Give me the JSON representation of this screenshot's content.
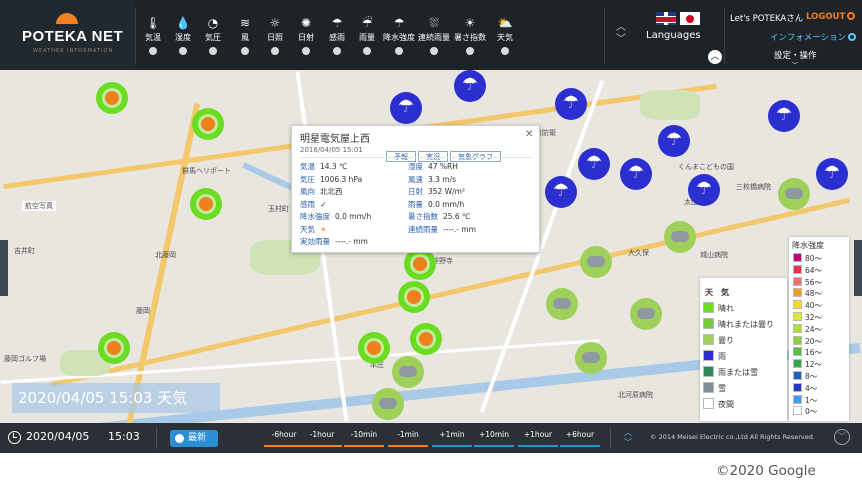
{
  "header": {
    "app_title": "POTEKA NET",
    "app_subtitle": "WEATHER INFORMATION",
    "tools": [
      {
        "label": "気温",
        "icon": "thermometer-icon",
        "glyph": "🌡"
      },
      {
        "label": "湿度",
        "icon": "droplet-icon",
        "glyph": "💧"
      },
      {
        "label": "気圧",
        "icon": "gauge-icon",
        "glyph": "◔"
      },
      {
        "label": "風",
        "icon": "wind-icon",
        "glyph": "≋"
      },
      {
        "label": "日照",
        "icon": "sunshine-icon",
        "glyph": "☼"
      },
      {
        "label": "日射",
        "icon": "solar-radiation-icon",
        "glyph": "✺"
      },
      {
        "label": "感雨",
        "icon": "umbrella-icon",
        "glyph": "☂"
      },
      {
        "label": "雨量",
        "icon": "rain-gauge-icon",
        "glyph": "☔"
      },
      {
        "label": "降水強度",
        "icon": "rain-intensity-icon",
        "glyph": "☂"
      },
      {
        "label": "連続雨量",
        "icon": "continuous-rain-icon",
        "glyph": "⛆"
      },
      {
        "label": "暑さ指数",
        "icon": "heat-index-icon",
        "glyph": "☀"
      },
      {
        "label": "天気",
        "icon": "weather-icon",
        "glyph": "⛅"
      }
    ],
    "languages_label": "Languages",
    "user_greeting": "Let's POTEKAさん",
    "logout_label": "LOGOUT",
    "information_label": "インフォメーション",
    "settings_label": "設定・操作"
  },
  "map": {
    "labels": [
      "航空写真",
      "群馬ヘリポート",
      "玉村町",
      "北藤岡",
      "吉井町",
      "熊野寺",
      "藤岡",
      "藤岡ゴルフ場",
      "東京防衛",
      "くんまこどもの国",
      "三枚橋病院",
      "太田",
      "城山病院",
      "本庄",
      "北河原病院",
      "大久保"
    ],
    "markers": [
      "sun",
      "sun",
      "sun",
      "sun",
      "sun",
      "sun",
      "sun",
      "sun",
      "cloud",
      "cloud",
      "cloud",
      "cloud",
      "cloud",
      "cloud",
      "cloud",
      "cloud",
      "rain",
      "rain",
      "rain",
      "rain",
      "rain",
      "rain",
      "rain",
      "rain",
      "rain",
      "rain"
    ]
  },
  "popup": {
    "title": "明星電気屋上西",
    "datetime": "2016/04/05 15:01",
    "tabs": [
      "予報",
      "実況",
      "気象グラフ"
    ],
    "left": [
      {
        "k": "気温",
        "v": "14.3 ℃"
      },
      {
        "k": "気圧",
        "v": "1006.3 hPa"
      },
      {
        "k": "風向",
        "v": "北北西"
      },
      {
        "k": "感雨",
        "v": "✓"
      },
      {
        "k": "降水強度",
        "v": "0.0 mm/h"
      },
      {
        "k": "天気",
        "v": "☀"
      },
      {
        "k": "実効雨量",
        "v": "----.- mm"
      }
    ],
    "right": [
      {
        "k": "湿度",
        "v": "47 %RH"
      },
      {
        "k": "風速",
        "v": "3.3 m/s"
      },
      {
        "k": "日射",
        "v": "352 W/m²"
      },
      {
        "k": "雨量",
        "v": "0.0 mm/h"
      },
      {
        "k": "暑さ指数",
        "v": "25.6 ℃"
      },
      {
        "k": "連続雨量",
        "v": "----.- mm"
      }
    ]
  },
  "weather_legend": {
    "title": "天　気",
    "items": [
      {
        "label": "晴れ",
        "color": "#6bdc22"
      },
      {
        "label": "晴れまたは曇り",
        "color": "#79c93c"
      },
      {
        "label": "曇り",
        "color": "#9ed05a"
      },
      {
        "label": "雨",
        "color": "#2c2fcf"
      },
      {
        "label": "雨または雪",
        "color": "#2f8a5a"
      },
      {
        "label": "雪",
        "color": "#7c8d96"
      },
      {
        "label": "夜間",
        "color": "#ffffff"
      }
    ]
  },
  "rain_legend": {
    "title": "降水強度",
    "items": [
      {
        "label": "80～",
        "color": "#c0007a"
      },
      {
        "label": "64～",
        "color": "#e8324b"
      },
      {
        "label": "56～",
        "color": "#f36f6f"
      },
      {
        "label": "48～",
        "color": "#f59a2b"
      },
      {
        "label": "40～",
        "color": "#f5d92b"
      },
      {
        "label": "32～",
        "color": "#d8ea31"
      },
      {
        "label": "24～",
        "color": "#b7dc36"
      },
      {
        "label": "20～",
        "color": "#8fce3b"
      },
      {
        "label": "16～",
        "color": "#55c13d"
      },
      {
        "label": "12～",
        "color": "#2ea94c"
      },
      {
        "label": "8～",
        "color": "#1e5fbd"
      },
      {
        "label": "4～",
        "color": "#2438c6"
      },
      {
        "label": "1～",
        "color": "#3a9df0"
      },
      {
        "label": "0～",
        "color": "#ffffff"
      }
    ]
  },
  "overlay_stamp": "2020/04/05 15:03 天気",
  "timebar": {
    "date": "2020/04/05",
    "time": "15:03",
    "latest_label": "最新",
    "steps": [
      {
        "label": "-6hour",
        "kind": "past"
      },
      {
        "label": "-1hour",
        "kind": "past"
      },
      {
        "label": "-10min",
        "kind": "past"
      },
      {
        "label": "-1min",
        "kind": "past"
      },
      {
        "label": "+1min",
        "kind": "future"
      },
      {
        "label": "+10min",
        "kind": "future"
      },
      {
        "label": "+1hour",
        "kind": "future"
      },
      {
        "label": "+6hour",
        "kind": "future"
      }
    ],
    "copyright": "© 2014 Meisei Electric co.,Ltd All Rights Reserved."
  },
  "attribution": "©2020 Google"
}
